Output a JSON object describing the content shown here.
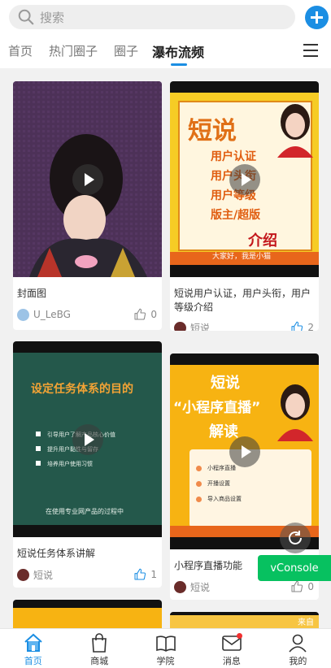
{
  "search": {
    "placeholder": "搜索"
  },
  "tabs": [
    {
      "label": "首页",
      "active": false
    },
    {
      "label": "热门圈子",
      "active": false
    },
    {
      "label": "圈子",
      "active": false
    },
    {
      "label": "瀑布流频",
      "active": true
    }
  ],
  "colors": {
    "accent": "#1b8ee3",
    "vconsole": "#07c160",
    "badge": "#f23030"
  },
  "cards": [
    {
      "title": "封面图",
      "author": "U_LeBG",
      "likes": "0",
      "liked": false
    },
    {
      "title": "短说用户认证，用户头衔，用户等级介绍",
      "author": "短说",
      "likes": "2",
      "liked": true,
      "cover_text": {
        "heading": "短说",
        "lines": [
          "用户认证",
          "用户头衔",
          "用户等级",
          "版主/超版"
        ],
        "footer": "介绍",
        "caption": "大家好，我是小猫"
      }
    },
    {
      "title": "短说任务体系讲解",
      "author": "短说",
      "likes": "1",
      "liked": true,
      "cover_text": {
        "heading": "设定任务体系的目的",
        "lines": [
          "引导用户了解产品核心价值",
          "提升用户黏性与留存",
          "培养用户使用习惯"
        ],
        "footer": "在使用专业网产品的过程中"
      }
    },
    {
      "title": "小程序直播功能",
      "author": "短说",
      "likes": "0",
      "liked": false,
      "cover_text": {
        "heading": "短说",
        "sub": "“小程序直播”",
        "third": "解读",
        "lines": [
          "小程序直播",
          "开播设置",
          "导入商品设置"
        ]
      }
    }
  ],
  "partial_card": {
    "label": "来自"
  },
  "vconsole": {
    "label": "vConsole"
  },
  "bottom_nav": [
    {
      "label": "首页",
      "icon": "home-icon",
      "active": true
    },
    {
      "label": "商城",
      "icon": "shopping-bag-icon",
      "active": false
    },
    {
      "label": "学院",
      "icon": "book-icon",
      "active": false
    },
    {
      "label": "消息",
      "icon": "mail-icon",
      "active": false,
      "badge": true
    },
    {
      "label": "我的",
      "icon": "user-icon",
      "active": false
    }
  ]
}
